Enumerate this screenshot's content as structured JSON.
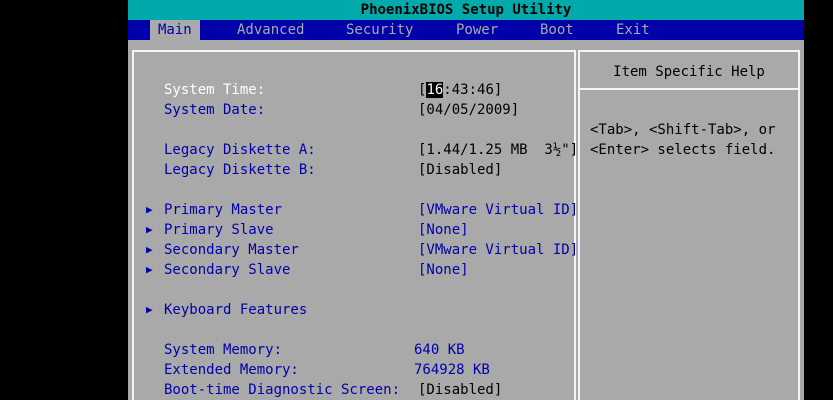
{
  "title": "PhoenixBIOS Setup Utility",
  "menu": [
    "Main",
    "Advanced",
    "Security",
    "Power",
    "Boot",
    "Exit"
  ],
  "active_menu": "Main",
  "help": {
    "title": "Item Specific Help",
    "lines": [
      "<Tab>, <Shift-Tab>, or",
      "<Enter> selects field."
    ]
  },
  "fields": {
    "system_time": {
      "label": "System Time:",
      "open": "[",
      "cursor": "16",
      "rest": ":43:46]"
    },
    "system_date": {
      "label": "System Date:",
      "value": "[04/05/2009]"
    },
    "diskette_a": {
      "label": "Legacy Diskette A:",
      "value": "[1.44/1.25 MB  3½\"]"
    },
    "diskette_b": {
      "label": "Legacy Diskette B:",
      "value": "[Disabled]"
    },
    "primary_master": {
      "label": "Primary Master",
      "value": "[VMware Virtual ID]"
    },
    "primary_slave": {
      "label": "Primary Slave",
      "value": "[None]"
    },
    "secondary_master": {
      "label": "Secondary Master",
      "value": "[VMware Virtual ID]"
    },
    "secondary_slave": {
      "label": "Secondary Slave",
      "value": "[None]"
    },
    "keyboard_features": {
      "label": "Keyboard Features"
    },
    "system_memory": {
      "label": "System Memory:",
      "value": "640 KB"
    },
    "extended_memory": {
      "label": "Extended Memory:",
      "value": "764928 KB"
    },
    "boot_diag": {
      "label": "Boot-time Diagnostic Screen:",
      "value": "[Disabled]"
    }
  },
  "submenu_arrow_icon": "right-triangle-icon",
  "colors": {
    "title_bg": "#00aaaa",
    "menu_bg": "#0000aa",
    "panel_bg": "#a9a9a9",
    "label": "#0000aa",
    "selected": "#ffffff",
    "value": "#000000"
  }
}
